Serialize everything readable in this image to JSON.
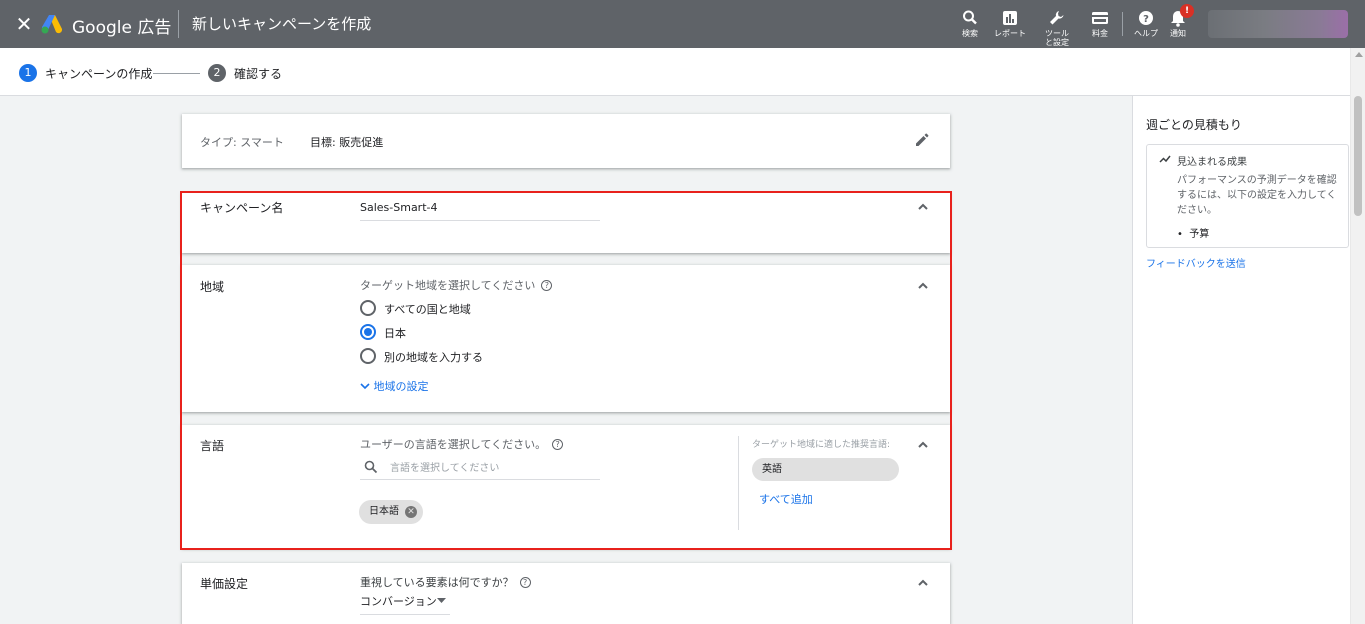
{
  "topbar": {
    "close_icon": "close-icon",
    "brand": "Google 広告",
    "title": "新しいキャンペーンを作成",
    "items": [
      {
        "icon": "search-icon",
        "label": "検索"
      },
      {
        "icon": "report-icon",
        "label": "レポート"
      },
      {
        "icon": "wrench-icon",
        "label": "ツールと設定"
      },
      {
        "icon": "billing-icon",
        "label": "料金"
      },
      {
        "icon": "help-icon",
        "label": "ヘルプ"
      },
      {
        "icon": "bell-icon",
        "label": "通知",
        "badge": "!"
      }
    ]
  },
  "stepper": {
    "steps": [
      {
        "num": "1",
        "label": "キャンペーンの作成",
        "active": true
      },
      {
        "num": "2",
        "label": "確認する",
        "active": false
      }
    ]
  },
  "summary": {
    "type_label": "タイプ: スマート",
    "goal_label": "目標: 販売促進",
    "edit_icon": "pencil-icon"
  },
  "campaign_name": {
    "label": "キャンペーン名",
    "value": "Sales-Smart-4"
  },
  "region": {
    "label": "地域",
    "prompt": "ターゲット地域を選択してください",
    "options": [
      {
        "label": "すべての国と地域",
        "selected": false
      },
      {
        "label": "日本",
        "selected": true
      },
      {
        "label": "別の地域を入力する",
        "selected": false
      }
    ],
    "settings_link": "地域の設定"
  },
  "language": {
    "label": "言語",
    "prompt": "ユーザーの言語を選択してください。",
    "search_placeholder": "言語を選択してください",
    "selected_chips": [
      "日本語"
    ],
    "recommend_title": "ターゲット地域に適した推奨言語:",
    "recommend_chips": [
      "英語"
    ],
    "add_all": "すべて追加"
  },
  "bidding": {
    "label": "単価設定",
    "prompt": "重視している要素は何ですか？",
    "dropdown_value": "コンバージョン"
  },
  "right_panel": {
    "title": "週ごとの見積もり",
    "box_title": "見込まれる成果",
    "description": "パフォーマンスの予測データを確認するには、以下の設定を入力してください。",
    "bullet": "予算",
    "feedback_link": "フィードバックを送信"
  },
  "colors": {
    "topbar_bg": "#5f6368",
    "accent_blue": "#1a73e8",
    "highlight_red": "#e8211c",
    "badge_red": "#d93025"
  }
}
